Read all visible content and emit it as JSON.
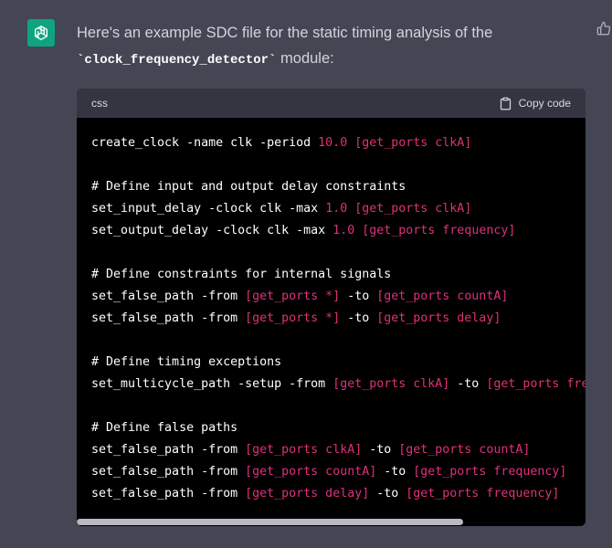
{
  "message": {
    "intro_before": "Here's an example SDC file for the static timing analysis of the",
    "module_name": "`clock_frequency_detector`",
    "intro_after": " module:"
  },
  "icons": {
    "avatar": "openai-logo-icon",
    "feedback": "thumbs-up-icon",
    "copy": "clipboard-icon"
  },
  "colors": {
    "background": "#444654",
    "avatar": "#10a37f",
    "code_bg": "#000000",
    "header_bg": "#343541",
    "string_token": "#df3079"
  },
  "code": {
    "language": "css",
    "copy_label": "Copy code",
    "lines": [
      [
        {
          "t": "create_clock -name clk -period ",
          "c": "plain"
        },
        {
          "t": "10.0",
          "c": "red"
        },
        {
          "t": " ",
          "c": "plain"
        },
        {
          "t": "[get_ports clkA]",
          "c": "red"
        }
      ],
      [],
      [
        {
          "t": "# Define input and output delay constraints",
          "c": "plain"
        }
      ],
      [
        {
          "t": "set_input_delay -clock clk -max ",
          "c": "plain"
        },
        {
          "t": "1.0",
          "c": "red"
        },
        {
          "t": " ",
          "c": "plain"
        },
        {
          "t": "[get_ports clkA]",
          "c": "red"
        }
      ],
      [
        {
          "t": "set_output_delay -clock clk -max ",
          "c": "plain"
        },
        {
          "t": "1.0",
          "c": "red"
        },
        {
          "t": " ",
          "c": "plain"
        },
        {
          "t": "[get_ports frequency]",
          "c": "red"
        }
      ],
      [],
      [
        {
          "t": "# Define constraints for internal signals",
          "c": "plain"
        }
      ],
      [
        {
          "t": "set_false_path -from ",
          "c": "plain"
        },
        {
          "t": "[get_ports *]",
          "c": "red"
        },
        {
          "t": " -to ",
          "c": "plain"
        },
        {
          "t": "[get_ports countA]",
          "c": "red"
        }
      ],
      [
        {
          "t": "set_false_path -from ",
          "c": "plain"
        },
        {
          "t": "[get_ports *]",
          "c": "red"
        },
        {
          "t": " -to ",
          "c": "plain"
        },
        {
          "t": "[get_ports delay]",
          "c": "red"
        }
      ],
      [],
      [
        {
          "t": "# Define timing exceptions",
          "c": "plain"
        }
      ],
      [
        {
          "t": "set_multicycle_path -setup -from ",
          "c": "plain"
        },
        {
          "t": "[get_ports clkA]",
          "c": "red"
        },
        {
          "t": " -to ",
          "c": "plain"
        },
        {
          "t": "[get_ports freque",
          "c": "red"
        }
      ],
      [],
      [
        {
          "t": "# Define false paths",
          "c": "plain"
        }
      ],
      [
        {
          "t": "set_false_path -from ",
          "c": "plain"
        },
        {
          "t": "[get_ports clkA]",
          "c": "red"
        },
        {
          "t": " -to ",
          "c": "plain"
        },
        {
          "t": "[get_ports countA]",
          "c": "red"
        }
      ],
      [
        {
          "t": "set_false_path -from ",
          "c": "plain"
        },
        {
          "t": "[get_ports countA]",
          "c": "red"
        },
        {
          "t": " -to ",
          "c": "plain"
        },
        {
          "t": "[get_ports frequency]",
          "c": "red"
        }
      ],
      [
        {
          "t": "set_false_path -from ",
          "c": "plain"
        },
        {
          "t": "[get_ports delay]",
          "c": "red"
        },
        {
          "t": " -to ",
          "c": "plain"
        },
        {
          "t": "[get_ports frequency]",
          "c": "red"
        }
      ]
    ],
    "horizontal_scroll_fraction": 0.76
  }
}
